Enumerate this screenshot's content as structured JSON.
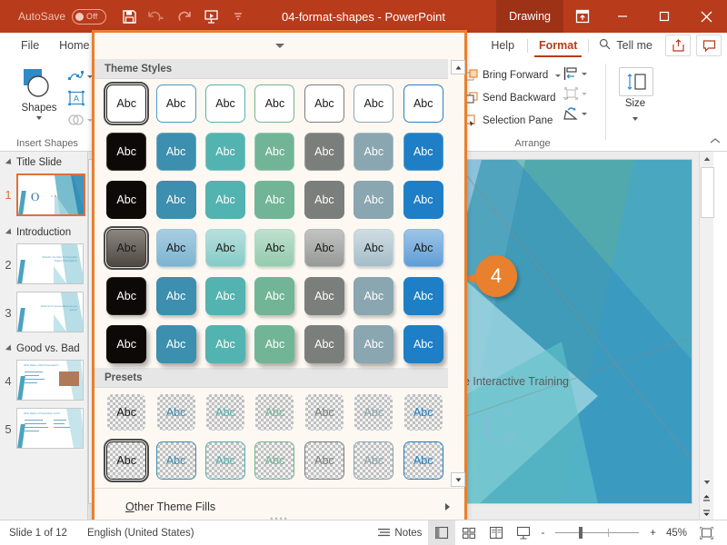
{
  "titlebar": {
    "autosave_label": "AutoSave",
    "autosave_state": "Off",
    "document_title": "04-format-shapes  -  PowerPoint",
    "contextual_tab": "Drawing",
    "qat": [
      {
        "name": "save-icon",
        "label": "Save"
      },
      {
        "name": "undo-icon",
        "label": "Undo"
      },
      {
        "name": "redo-icon",
        "label": "Redo"
      },
      {
        "name": "start-slideshow-icon",
        "label": "Start From Beginning"
      },
      {
        "name": "customize-qat-icon",
        "label": "Customize Quick Access Toolbar"
      }
    ],
    "window_controls": [
      "ribbon-display-options",
      "minimize",
      "restore",
      "close"
    ]
  },
  "ribbon": {
    "tabs_left": [
      "File",
      "Home"
    ],
    "tabs_right": [
      "Help"
    ],
    "active_tab": "Format",
    "tell_me": "Tell me",
    "share_label": "Share",
    "comments_label": "Comments",
    "groups": {
      "insert_shapes": {
        "label": "Insert Shapes",
        "shapes_button": "Shapes"
      },
      "arrange": {
        "label": "Arrange",
        "items": [
          "Bring Forward",
          "Send Backward",
          "Selection Pane"
        ],
        "icons": [
          "align-icon",
          "group-icon",
          "rotate-icon"
        ]
      },
      "size": {
        "label": "Size"
      }
    }
  },
  "sidebar": {
    "sections": [
      {
        "title": "Title Slide",
        "slides": [
          {
            "number": "1",
            "selected": true,
            "lines": []
          }
        ]
      },
      {
        "title": "Introduction",
        "slides": [
          {
            "number": "2",
            "selected": false,
            "lines": [
              "What Do You Want To",
              "Know After Today's",
              "Presentation?"
            ]
          },
          {
            "number": "3",
            "selected": false,
            "lines": [
              "What kind of presentations",
              "are you giving?"
            ]
          }
        ]
      },
      {
        "title": "Good vs. Bad",
        "slides": [
          {
            "number": "4",
            "selected": false,
            "lines": [
              "What Makes a Bad Presentation?"
            ]
          },
          {
            "number": "5",
            "selected": false,
            "lines": [
              "What Makes a Presentation Good?"
            ]
          }
        ]
      }
    ]
  },
  "slide": {
    "subtitle": "de Interactive Training",
    "logo_letter": "G",
    "callout_number": "4"
  },
  "gallery": {
    "sections": [
      {
        "title": "Theme Styles",
        "rows": [
          {
            "style": "outline",
            "cells": [
              {
                "fill": "#ffffff",
                "border": "#1a1a1a",
                "text": "#1a1a1a",
                "label": "Abc",
                "selected": true
              },
              {
                "fill": "#ffffff",
                "border": "#4b9cc2",
                "text": "#1a1a1a",
                "label": "Abc",
                "selected": false
              },
              {
                "fill": "#ffffff",
                "border": "#55b3b3",
                "text": "#1a1a1a",
                "label": "Abc",
                "selected": false
              },
              {
                "fill": "#ffffff",
                "border": "#73b393",
                "text": "#1a1a1a",
                "label": "Abc",
                "selected": false
              },
              {
                "fill": "#ffffff",
                "border": "#7d7d7d",
                "text": "#1a1a1a",
                "label": "Abc",
                "selected": false
              },
              {
                "fill": "#ffffff",
                "border": "#8fa9b5",
                "text": "#1a1a1a",
                "label": "Abc",
                "selected": false
              },
              {
                "fill": "#ffffff",
                "border": "#2a7fc4",
                "text": "#1a1a1a",
                "label": "Abc",
                "selected": false
              }
            ]
          },
          {
            "style": "solid-thinborder",
            "cells": [
              {
                "fill": "#0d0906",
                "border": "#3d3833",
                "text": "#ffffff",
                "label": "Abc",
                "selected": false
              },
              {
                "fill": "#3c8fae",
                "border": "#6aa9c0",
                "text": "#ffffff",
                "label": "Abc",
                "selected": false
              },
              {
                "fill": "#53b3b0",
                "border": "#7dc6c4",
                "text": "#ffffff",
                "label": "Abc",
                "selected": false
              },
              {
                "fill": "#71b596",
                "border": "#96c9b2",
                "text": "#ffffff",
                "label": "Abc",
                "selected": false
              },
              {
                "fill": "#7a7f7c",
                "border": "#9a9e9c",
                "text": "#ffffff",
                "label": "Abc",
                "selected": false
              },
              {
                "fill": "#8aa6b0",
                "border": "#a8bec6",
                "text": "#ffffff",
                "label": "Abc",
                "selected": false
              },
              {
                "fill": "#1f7fc6",
                "border": "#569fd4",
                "text": "#ffffff",
                "label": "Abc",
                "selected": false
              }
            ]
          },
          {
            "style": "solid-flat",
            "cells": [
              {
                "fill": "#0d0906",
                "border": "none",
                "text": "#ffffff",
                "label": "Abc",
                "selected": false
              },
              {
                "fill": "#3c8fae",
                "border": "none",
                "text": "#ffffff",
                "label": "Abc",
                "selected": false
              },
              {
                "fill": "#53b3b0",
                "border": "none",
                "text": "#ffffff",
                "label": "Abc",
                "selected": false
              },
              {
                "fill": "#71b596",
                "border": "none",
                "text": "#ffffff",
                "label": "Abc",
                "selected": false
              },
              {
                "fill": "#7a7f7c",
                "border": "none",
                "text": "#ffffff",
                "label": "Abc",
                "selected": false
              },
              {
                "fill": "#8aa6b0",
                "border": "none",
                "text": "#ffffff",
                "label": "Abc",
                "selected": false
              },
              {
                "fill": "#1f7fc6",
                "border": "none",
                "text": "#ffffff",
                "label": "Abc",
                "selected": false
              }
            ]
          },
          {
            "style": "gradient-light",
            "cells": [
              {
                "fill": "#8c8680",
                "fill2": "#4d4842",
                "border": "#3a3530",
                "text": "#1a1a1a",
                "label": "Abc",
                "selected": true
              },
              {
                "fill": "#a9cde1",
                "fill2": "#7bb4d1",
                "border": "#9cc5dc",
                "text": "#1a1a1a",
                "label": "Abc",
                "selected": false
              },
              {
                "fill": "#b8e0dd",
                "fill2": "#86cbc7",
                "border": "#a9dad6",
                "text": "#1a1a1a",
                "label": "Abc",
                "selected": false
              },
              {
                "fill": "#bfe0cd",
                "fill2": "#94cbae",
                "border": "#b2dcc3",
                "text": "#1a1a1a",
                "label": "Abc",
                "selected": false
              },
              {
                "fill": "#c2c4c2",
                "fill2": "#979997",
                "border": "#b4b6b4",
                "text": "#1a1a1a",
                "label": "Abc",
                "selected": false
              },
              {
                "fill": "#cfdde2",
                "fill2": "#a5bdc7",
                "border": "#c1d4da",
                "text": "#1a1a1a",
                "label": "Abc",
                "selected": false
              },
              {
                "fill": "#9ec4e8",
                "fill2": "#5f9ed6",
                "border": "#8ab8e3",
                "text": "#1a1a1a",
                "label": "Abc",
                "selected": false
              }
            ]
          },
          {
            "style": "solid-shadow",
            "cells": [
              {
                "fill": "#0d0906",
                "border": "#2a2622",
                "text": "#ffffff",
                "label": "Abc",
                "selected": false
              },
              {
                "fill": "#3c8fae",
                "border": "none",
                "text": "#ffffff",
                "label": "Abc",
                "selected": false
              },
              {
                "fill": "#53b3b0",
                "border": "none",
                "text": "#ffffff",
                "label": "Abc",
                "selected": false
              },
              {
                "fill": "#71b596",
                "border": "none",
                "text": "#ffffff",
                "label": "Abc",
                "selected": false
              },
              {
                "fill": "#7a7f7c",
                "border": "none",
                "text": "#ffffff",
                "label": "Abc",
                "selected": false
              },
              {
                "fill": "#8aa6b0",
                "border": "none",
                "text": "#ffffff",
                "label": "Abc",
                "selected": false
              },
              {
                "fill": "#1f7fc6",
                "border": "none",
                "text": "#ffffff",
                "label": "Abc",
                "selected": false
              }
            ]
          },
          {
            "style": "solid-strong-shadow",
            "cells": [
              {
                "fill": "#0d0906",
                "border": "none",
                "text": "#ffffff",
                "label": "Abc",
                "selected": false
              },
              {
                "fill": "#3c8fae",
                "border": "none",
                "text": "#ffffff",
                "label": "Abc",
                "selected": false
              },
              {
                "fill": "#53b3b0",
                "border": "none",
                "text": "#ffffff",
                "label": "Abc",
                "selected": false
              },
              {
                "fill": "#71b596",
                "border": "none",
                "text": "#ffffff",
                "label": "Abc",
                "selected": false
              },
              {
                "fill": "#7a7f7c",
                "border": "none",
                "text": "#ffffff",
                "label": "Abc",
                "selected": false
              },
              {
                "fill": "#8aa6b0",
                "border": "none",
                "text": "#ffffff",
                "label": "Abc",
                "selected": false
              },
              {
                "fill": "#1f7fc6",
                "border": "none",
                "text": "#ffffff",
                "label": "Abc",
                "selected": false
              }
            ]
          }
        ]
      },
      {
        "title": "Presets",
        "rows": [
          {
            "style": "transparent-noborder",
            "cells": [
              {
                "fill": "transparent",
                "border": "none",
                "text": "#1a1a1a",
                "label": "Abc",
                "selected": false
              },
              {
                "fill": "transparent",
                "border": "none",
                "text": "#3c8fae",
                "label": "Abc",
                "selected": false
              },
              {
                "fill": "transparent",
                "border": "none",
                "text": "#53b3b0",
                "label": "Abc",
                "selected": false
              },
              {
                "fill": "transparent",
                "border": "none",
                "text": "#71b596",
                "label": "Abc",
                "selected": false
              },
              {
                "fill": "transparent",
                "border": "none",
                "text": "#7a7f7c",
                "label": "Abc",
                "selected": false
              },
              {
                "fill": "transparent",
                "border": "none",
                "text": "#8aa6b0",
                "label": "Abc",
                "selected": false
              },
              {
                "fill": "transparent",
                "border": "none",
                "text": "#1f7fc6",
                "label": "Abc",
                "selected": false
              }
            ]
          },
          {
            "style": "transparent-border",
            "cells": [
              {
                "fill": "transparent",
                "border": "#1a1a1a",
                "text": "#1a1a1a",
                "label": "Abc",
                "selected": true
              },
              {
                "fill": "transparent",
                "border": "#3c8fae",
                "text": "#3c8fae",
                "label": "Abc",
                "selected": false
              },
              {
                "fill": "transparent",
                "border": "#53b3b0",
                "text": "#53b3b0",
                "label": "Abc",
                "selected": false
              },
              {
                "fill": "transparent",
                "border": "#71b596",
                "text": "#71b596",
                "label": "Abc",
                "selected": false
              },
              {
                "fill": "transparent",
                "border": "#7a7f7c",
                "text": "#7a7f7c",
                "label": "Abc",
                "selected": false
              },
              {
                "fill": "transparent",
                "border": "#8aa6b0",
                "text": "#8aa6b0",
                "label": "Abc",
                "selected": false
              },
              {
                "fill": "transparent",
                "border": "#1f7fc6",
                "text": "#1f7fc6",
                "label": "Abc",
                "selected": false
              }
            ]
          }
        ]
      }
    ],
    "footer_label_prefix": "O",
    "footer_label_rest": "ther Theme Fills"
  },
  "statusbar": {
    "slide_count": "Slide 1 of 12",
    "language": "English (United States)",
    "notes_label": "Notes",
    "views": [
      "normal-view",
      "slide-sorter-view",
      "reading-view",
      "slideshow-view"
    ],
    "zoom_level": "45%",
    "zoom_out": "-",
    "zoom_in": "+"
  },
  "colors": {
    "brand": "#b83b1c",
    "accent_orange": "#e8802e",
    "contextual_tab": "#9e3217"
  }
}
